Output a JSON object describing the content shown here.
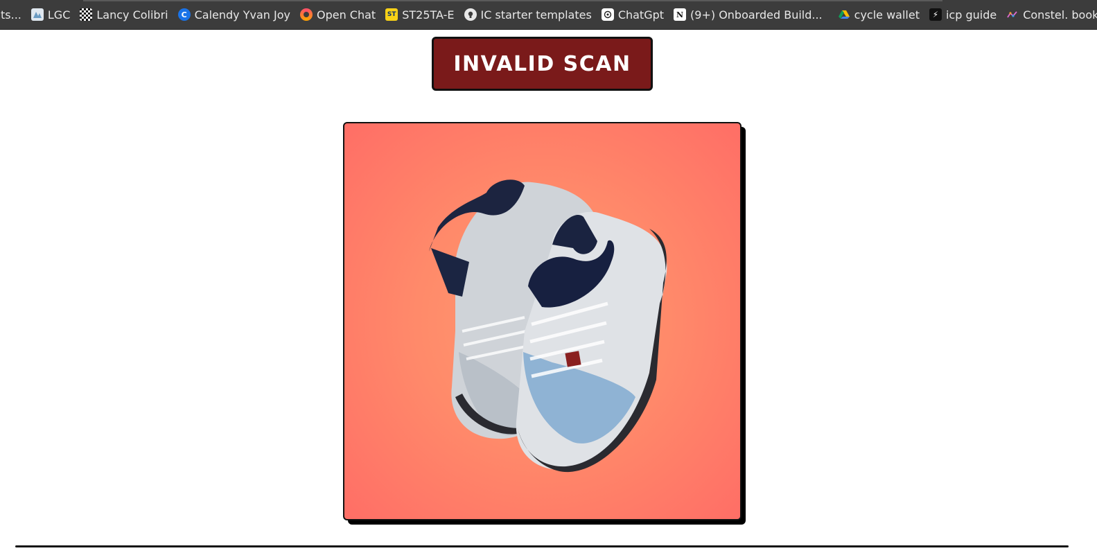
{
  "bookmarks": [
    {
      "label": "ts...",
      "icon": "none"
    },
    {
      "label": "LGC",
      "icon": "map-icon"
    },
    {
      "label": "Lancy Colibri",
      "icon": "checker-icon"
    },
    {
      "label": "Calendy Yvan Joy",
      "icon": "calendly-icon"
    },
    {
      "label": "Open Chat",
      "icon": "openchat-icon"
    },
    {
      "label": "ST25TA-E",
      "icon": "st-icon"
    },
    {
      "label": "IC starter templates",
      "icon": "github-icon"
    },
    {
      "label": "ChatGpt",
      "icon": "chatgpt-icon"
    },
    {
      "label": "(9+) Onboarded Build...",
      "icon": "notion-icon"
    },
    {
      "label": "cycle wallet",
      "icon": "drive-icon"
    },
    {
      "label": "icp guide",
      "icon": "bolt-icon"
    },
    {
      "label": "Constel. book Proton",
      "icon": "constellation-icon"
    }
  ],
  "status": {
    "label": "INVALID SCAN",
    "color": "#7a1a1a"
  },
  "scan_image": {
    "subject": "pair of high-top sneakers",
    "background_color": "#ff8a6a"
  }
}
